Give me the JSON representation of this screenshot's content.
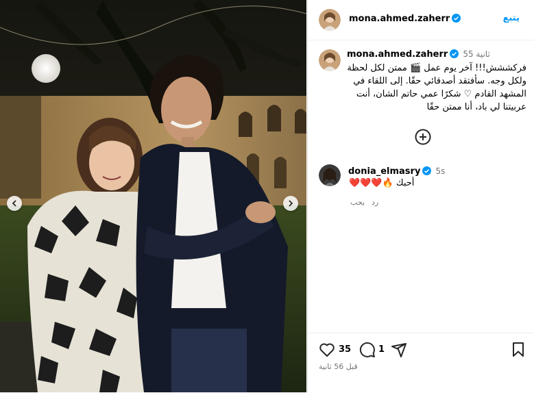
{
  "post": {
    "author": "mona.ahmed.zaherr",
    "follow_label": "يتبع",
    "caption_time": "55 ثانية",
    "caption_lines": [
      "فركششش!!! آخر يوم عمل 🎬 ممتن لكل لحظة",
      "ولكل وجه. سأفتقد أصدقائي حقًا. إلى اللقاء في",
      "المشهد القادم ♡ شكرًا عمي حاتم الشان، أنت",
      "عربيتنا لي باد، أنا ممتن حقًا"
    ]
  },
  "comment": {
    "author": "donia_elmasry",
    "time": "5s",
    "text": "أحبك 🔥❤️❤️❤️",
    "reply_label": "رد",
    "like_label": "يحب"
  },
  "actions": {
    "likes_count": "35",
    "comments_count": "1",
    "posted_ago": "قبل 56 ثانية"
  },
  "colors": {
    "accent": "#0095f6",
    "heart": "#e0242b",
    "secondary_text": "#737373"
  }
}
